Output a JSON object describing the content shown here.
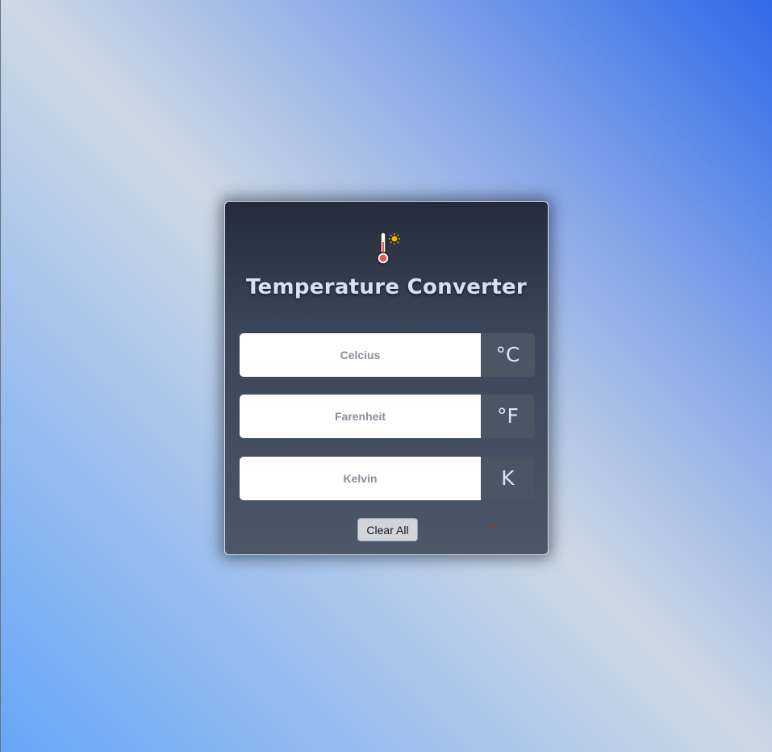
{
  "app": {
    "title": "Temperature Converter",
    "icon": "thermometer-sun-icon"
  },
  "fields": [
    {
      "placeholder": "Celcius",
      "value": "",
      "unit": "°C"
    },
    {
      "placeholder": "Farenheit",
      "value": "",
      "unit": "°F"
    },
    {
      "placeholder": "Kelvin",
      "value": "",
      "unit": "K"
    }
  ],
  "actions": {
    "clear_label": "Clear All",
    "close_glyph": "×"
  },
  "colors": {
    "card_top": "#242c3c",
    "card_bottom": "#4c5768",
    "unit_bg": "#4b5563",
    "title": "#d6e2f2",
    "button_bg": "#d1d5db",
    "close_mark": "#b42a2a"
  }
}
